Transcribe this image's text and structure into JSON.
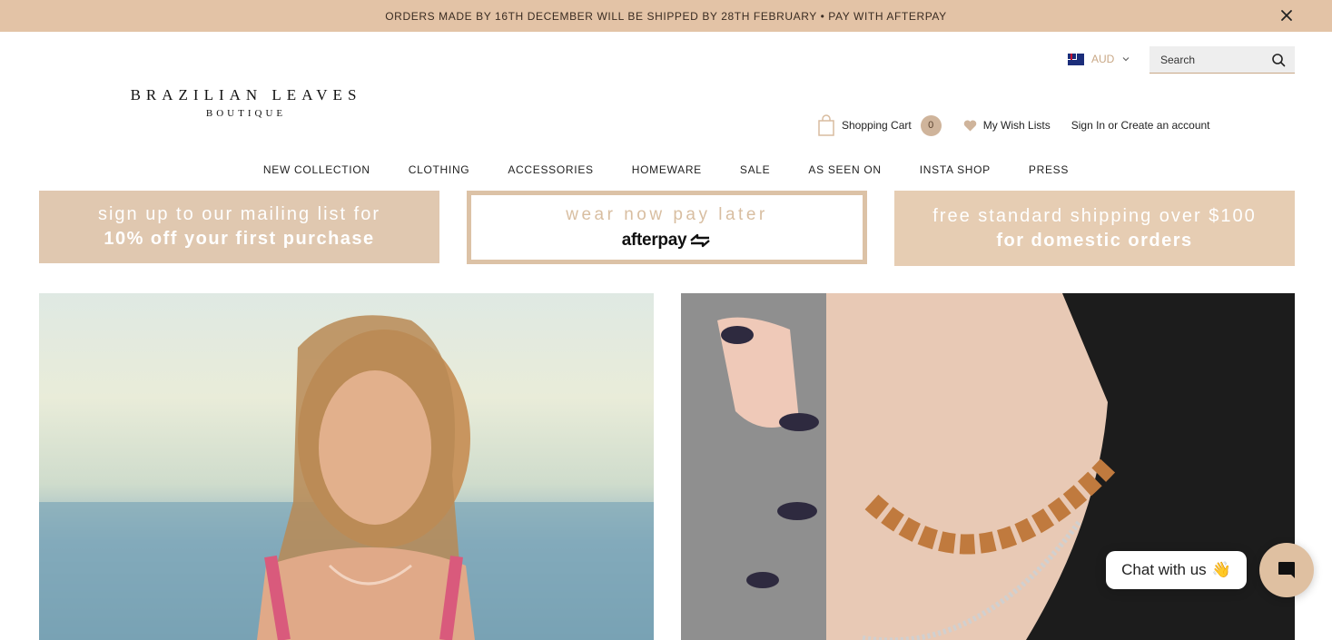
{
  "announcement": {
    "text": "ORDERS MADE BY 16TH DECEMBER WILL BE SHIPPED BY 28TH FEBRUARY • PAY WITH AFTERPAY"
  },
  "brand": {
    "name": "BRAZILIAN LEAVES",
    "tagline": "BOUTIQUE"
  },
  "currency": {
    "selected": "AUD",
    "flag_icon": "australia-flag-icon"
  },
  "search": {
    "placeholder": "Search"
  },
  "account": {
    "cart_label": "Shopping Cart",
    "cart_count": "0",
    "wishlist_label": "My Wish Lists",
    "sign_in": "Sign In",
    "or": " or ",
    "create_account": "Create an account"
  },
  "nav": {
    "items": [
      "NEW COLLECTION",
      "CLOTHING",
      "ACCESSORIES",
      "HOMEWARE",
      "SALE",
      "AS SEEN ON",
      "INSTA SHOP",
      "PRESS"
    ]
  },
  "promos": {
    "mailing": {
      "line1": "sign up to our mailing list for",
      "line2": "10% off your first purchase"
    },
    "afterpay": {
      "line1": "wear now pay later",
      "logo_text": "afterpay"
    },
    "shipping": {
      "line1": "free standard shipping over $100",
      "line2": "for domestic orders"
    }
  },
  "chat": {
    "label": "Chat with us",
    "emoji": "👋"
  },
  "colors": {
    "announcement_bg": "#e3c3a6",
    "accent": "#c9a886",
    "chat_button": "#dfc0a1"
  }
}
